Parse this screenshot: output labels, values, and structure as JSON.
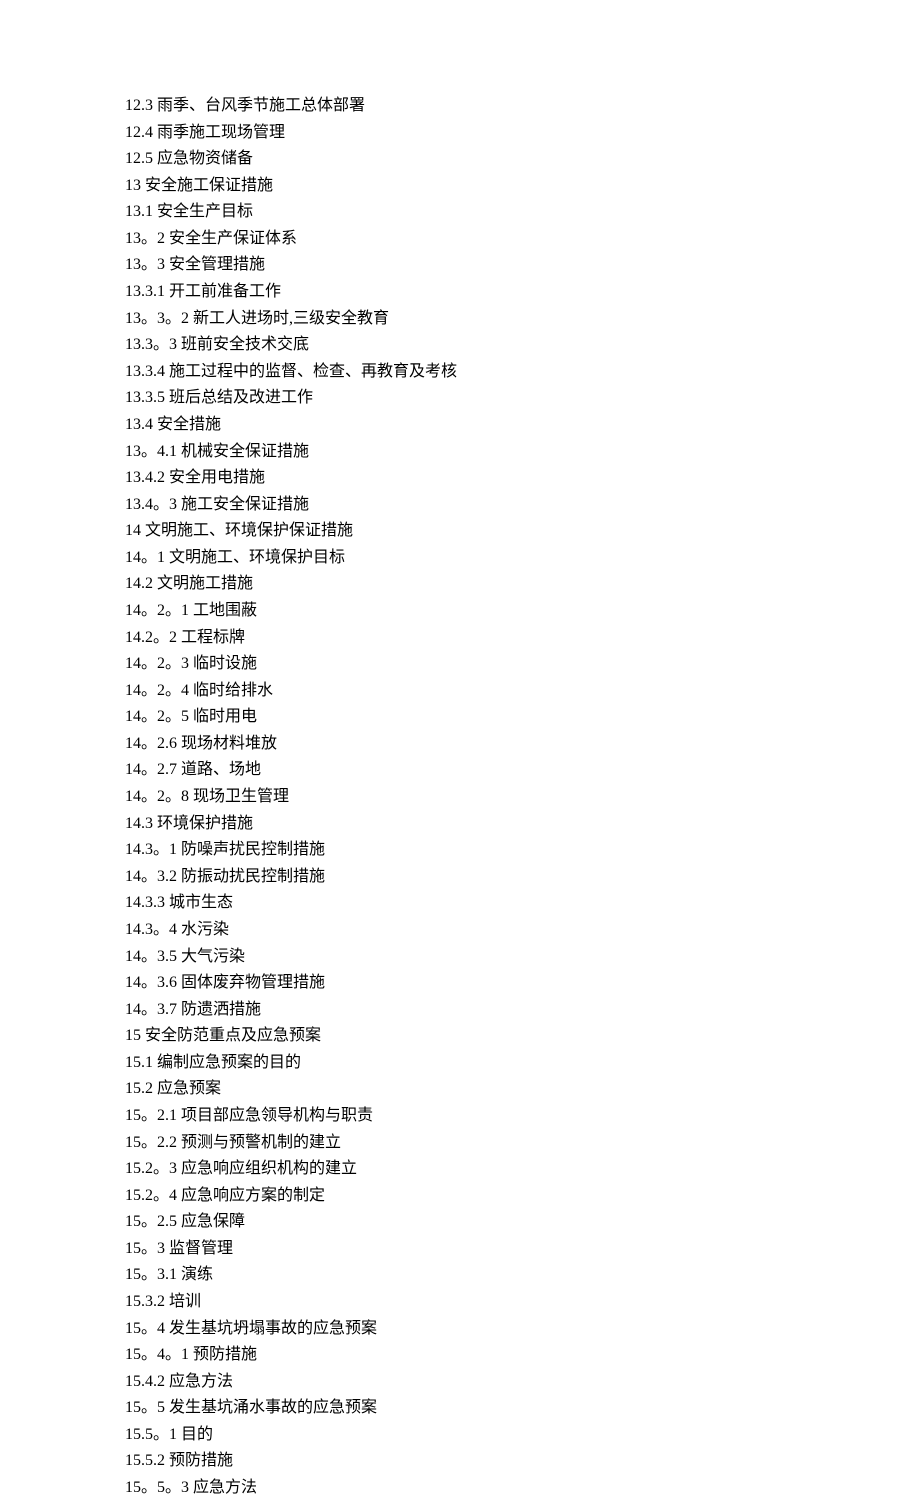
{
  "toc": [
    "12.3 雨季、台风季节施工总体部署",
    "12.4 雨季施工现场管理",
    "12.5 应急物资储备",
    "13 安全施工保证措施",
    "13.1 安全生产目标",
    "13。2 安全生产保证体系",
    "13。3 安全管理措施",
    "13.3.1 开工前准备工作",
    "13。3。2 新工人进场时,三级安全教育",
    "13.3。3 班前安全技术交底",
    "13.3.4 施工过程中的监督、检查、再教育及考核",
    "13.3.5 班后总结及改进工作",
    "13.4 安全措施",
    "13。4.1 机械安全保证措施",
    "13.4.2 安全用电措施",
    "13.4。3 施工安全保证措施",
    "14 文明施工、环境保护保证措施",
    "14。1 文明施工、环境保护目标",
    "14.2 文明施工措施",
    "14。2。1 工地围蔽",
    "14.2。2 工程标牌",
    "14。2。3 临时设施",
    "14。2。4 临时给排水",
    "14。2。5 临时用电",
    "14。2.6 现场材料堆放",
    "14。2.7 道路、场地",
    "14。2。8 现场卫生管理",
    "14.3 环境保护措施",
    "14.3。1 防噪声扰民控制措施",
    "14。3.2 防振动扰民控制措施",
    "14.3.3 城市生态",
    "14.3。4 水污染",
    "14。3.5 大气污染",
    "14。3.6 固体废弃物管理措施",
    "14。3.7 防遗洒措施",
    "15 安全防范重点及应急预案",
    "15.1 编制应急预案的目的",
    "15.2 应急预案",
    "15。2.1 项目部应急领导机构与职责",
    "15。2.2 预测与预警机制的建立",
    "15.2。3 应急响应组织机构的建立",
    "15.2。4 应急响应方案的制定",
    "15。2.5 应急保障",
    "15。3 监督管理",
    "15。3.1 演练",
    "15.3.2 培训",
    "15。4 发生基坑坍塌事故的应急预案",
    "15。4。1 预防措施",
    "15.4.2 应急方法",
    "15。5 发生基坑涌水事故的应急预案",
    "15.5。1 目的",
    "15.5.2 预防措施",
    "15。5。3 应急方法"
  ]
}
